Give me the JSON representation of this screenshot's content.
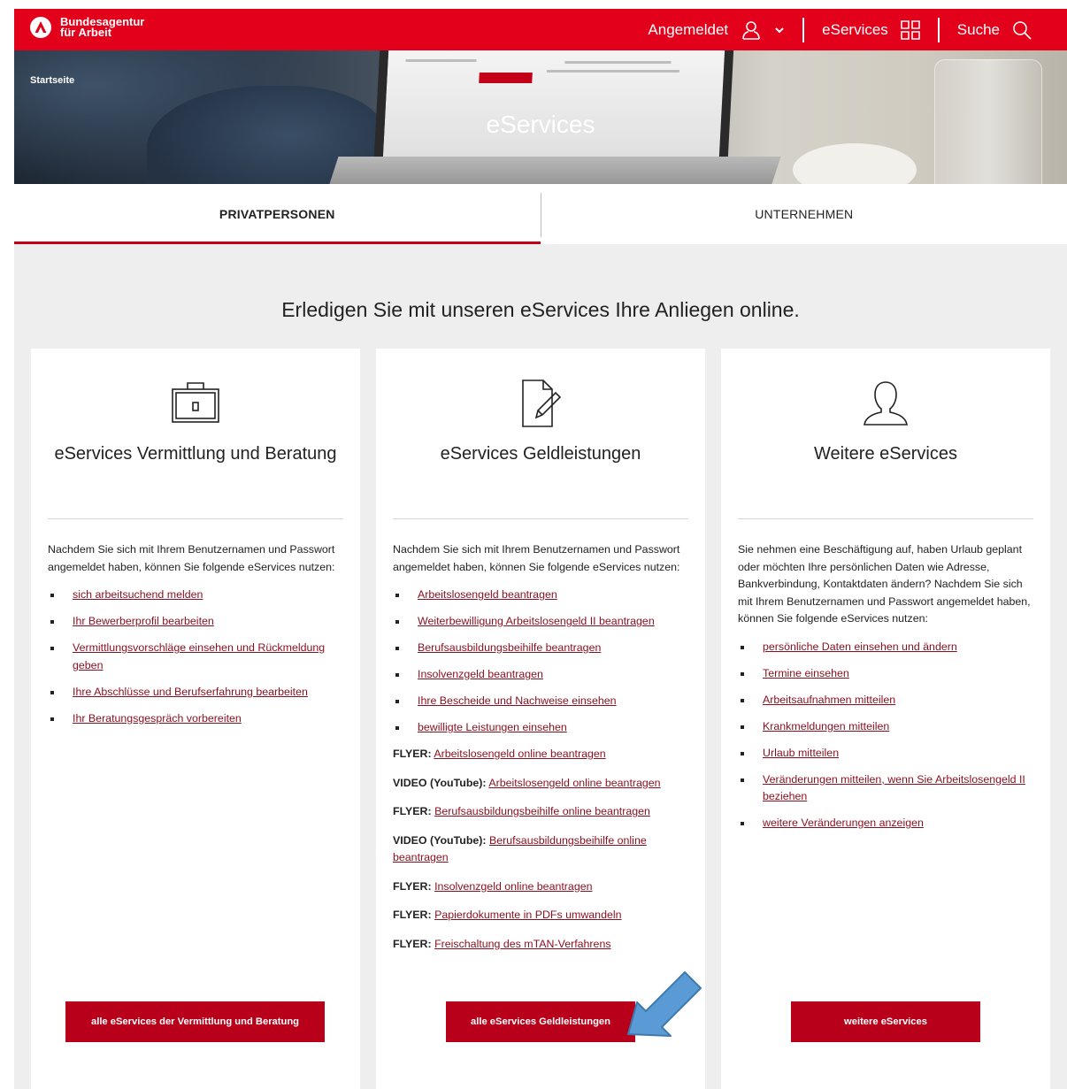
{
  "header": {
    "logo_line1": "Bundesagentur",
    "logo_line2": "für Arbeit",
    "nav_login": "Angemeldet",
    "nav_eservices": "eServices",
    "nav_search": "Suche"
  },
  "hero": {
    "breadcrumb": "Startseite",
    "title": "eServices"
  },
  "tabs": [
    "PRIVATPERSONEN",
    "UNTERNEHMEN"
  ],
  "headline": "Erledigen Sie mit unseren eServices Ihre Anliegen online.",
  "cards": [
    {
      "icon": "briefcase-icon",
      "title": "eServices Vermittlung und Beratung",
      "intro": "Nachdem Sie sich mit Ihrem Benutzernamen und Passwort angemeldet haben, können Sie folgende eServices nutzen:",
      "links": [
        "sich arbeitsuchend melden",
        "Ihr Bewerberprofil bearbeiten",
        "Vermittlungsvorschläge einsehen und Rückmeldung geben",
        "Ihre Abschlüsse und Berufserfahrung bearbeiten",
        "Ihr Beratungsgespräch vorbereiten"
      ],
      "cta": "alle eServices der Vermittlung und Beratung"
    },
    {
      "icon": "document-edit-icon",
      "title": "eServices Geldleistungen",
      "intro": "Nachdem Sie sich mit Ihrem Benutzernamen und Passwort angemeldet haben, können Sie folgende eServices nutzen:",
      "links": [
        "Arbeitslosengeld beantragen",
        "Weiterbewilligung Arbeitslosengeld II beantragen",
        "Berufsausbildungsbeihilfe beantragen",
        "Insolvenzgeld beantragen",
        "Ihre Bescheide und Nachweise einsehen",
        "bewilligte Leistungen einsehen"
      ],
      "extras": [
        {
          "label": "FLYER:",
          "link": "Arbeitslosengeld online beantragen"
        },
        {
          "label": "VIDEO (YouTube):",
          "link": "Arbeitslosengeld online beantragen"
        },
        {
          "label": "FLYER:",
          "link": "Berufsausbildungsbeihilfe online beantragen"
        },
        {
          "label": "VIDEO (YouTube):",
          "link": "Berufsausbildungsbeihilfe online beantragen"
        },
        {
          "label": "FLYER:",
          "link": "Insolvenzgeld online beantragen"
        },
        {
          "label": "FLYER:",
          "link": "Papierdokumente in PDFs umwandeln"
        },
        {
          "label": "FLYER:",
          "link": "Freischaltung des mTAN-Verfahrens"
        }
      ],
      "cta": "alle eServices Geldleistungen"
    },
    {
      "icon": "user-icon",
      "title": "Weitere eServices",
      "intro": "Sie nehmen eine Beschäftigung auf, haben Urlaub geplant oder möchten Ihre persönlichen Daten wie Adresse, Bankverbindung, Kontaktdaten ändern? Nachdem Sie sich mit Ihrem Benutzernamen und Passwort angemeldet haben, können Sie folgende eServices nutzen:",
      "links": [
        "persönliche Daten einsehen und ändern",
        "Termine einsehen",
        "Arbeitsaufnahmen mitteilen",
        "Krankmeldungen mitteilen",
        "Urlaub mitteilen",
        "Veränderungen mitteilen, wenn Sie Arbeitslosengeld II beziehen",
        "weitere Veränderungen anzeigen"
      ],
      "cta": "weitere eServices"
    }
  ],
  "colors": {
    "brand_red": "#e2001a",
    "button_red": "#b8001a",
    "link_red": "#8a0f1e",
    "page_bg": "#eeeeee",
    "annotation_arrow": "#5b9bd5"
  }
}
